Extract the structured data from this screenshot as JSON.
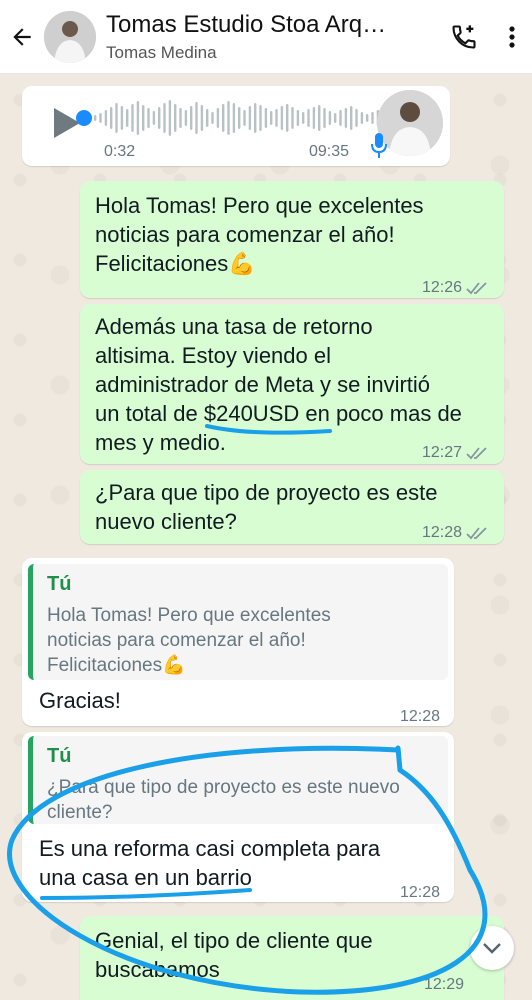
{
  "colors": {
    "outgoing_bubble": "#d9fdd3",
    "incoming_bubble": "#ffffff",
    "accent_green": "#25a55f",
    "ink_annotation": "#1aa0e8",
    "voice_accent": "#1a8cff"
  },
  "header": {
    "title": "Tomas Estudio Stoa Arq…",
    "subtitle": "Tomas Medina",
    "icons": [
      "back-arrow-icon",
      "add-call-icon",
      "more-vert-icon"
    ]
  },
  "voice_note": {
    "current_time": "0:32",
    "duration": "09:35",
    "progress": 0.06
  },
  "messages": [
    {
      "id": "m1",
      "direction": "out",
      "text": "Hola Tomas! Pero que excelentes\nnoticias para comenzar el año!\nFelicitaciones💪",
      "time": "12:26"
    },
    {
      "id": "m2",
      "direction": "out",
      "text": "Además una tasa de retorno\naltisima. Estoy viendo el\nadministrador de Meta y se invirtió\nun total de $240USD en poco mas de\nmes y medio.",
      "time": "12:27"
    },
    {
      "id": "m3",
      "direction": "out",
      "text": "¿Para que tipo de proyecto es este\nnuevo cliente?",
      "time": "12:28"
    },
    {
      "id": "m4",
      "direction": "in",
      "quote_author": "Tú",
      "quote_text": "Hola Tomas! Pero que excelentes\nnoticias para comenzar el año!\nFelicitaciones💪",
      "text": "Gracias!",
      "time": "12:28"
    },
    {
      "id": "m5",
      "direction": "in",
      "quote_author": "Tú",
      "quote_text": "¿Para que tipo de proyecto es este nuevo\ncliente?",
      "text": "Es una reforma casi completa para\nuna casa en un barrio",
      "time": "12:28"
    },
    {
      "id": "m6",
      "direction": "out",
      "text": "Genial, el tipo de cliente que\nbuscabamos",
      "time": "12:29"
    }
  ]
}
